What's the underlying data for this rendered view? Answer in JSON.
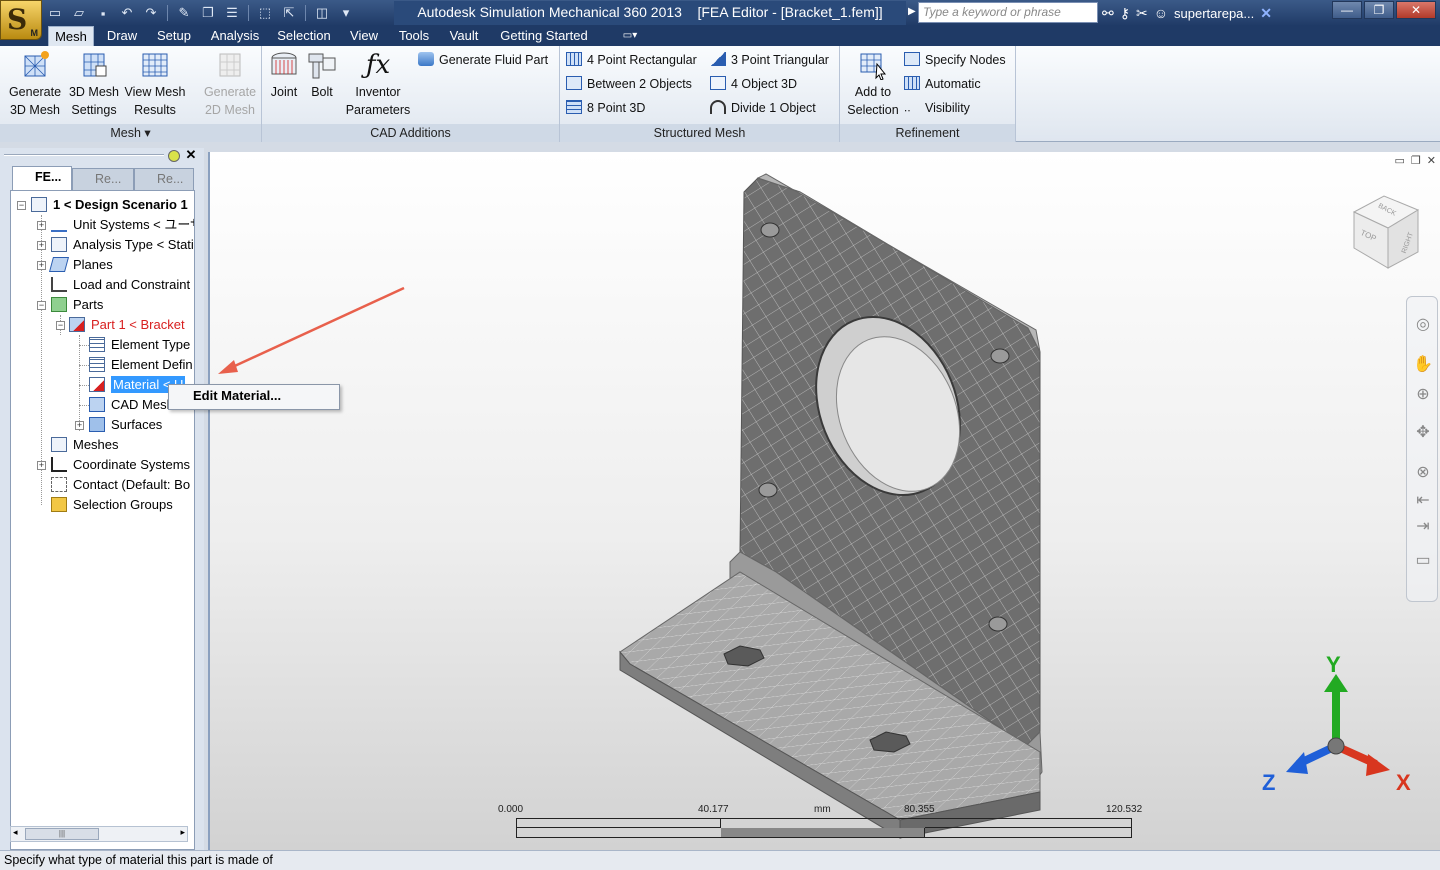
{
  "app": {
    "title": "Autodesk Simulation Mechanical 360 2013    [FEA Editor - [Bracket_1.fem]]",
    "logo_letter": "S",
    "logo_sub": "M",
    "search_placeholder": "Type a keyword or phrase",
    "user": "supertarepa..."
  },
  "menu": {
    "tabs": [
      "Mesh",
      "Draw",
      "Setup",
      "Analysis",
      "Selection",
      "View",
      "Tools",
      "Vault",
      "Getting Started"
    ],
    "active": "Mesh"
  },
  "ribbon": {
    "mesh_panel": {
      "label": "Mesh",
      "buttons": [
        {
          "line1": "Generate",
          "line2": "3D Mesh"
        },
        {
          "line1": "3D Mesh",
          "line2": "Settings"
        },
        {
          "line1": "View Mesh",
          "line2": "Results"
        },
        {
          "line1": "Generate",
          "line2": "2D Mesh"
        }
      ]
    },
    "cad_panel": {
      "label": "CAD Additions",
      "joint": "Joint",
      "bolt": "Bolt",
      "inventor_line1": "Inventor",
      "inventor_line2": "Parameters",
      "fluid": "Generate Fluid Part"
    },
    "structured_panel": {
      "label": "Structured Mesh",
      "items": [
        "4 Point Rectangular",
        "Between 2 Objects",
        "8 Point 3D",
        "3 Point Triangular",
        "4 Object 3D",
        "Divide 1 Object"
      ]
    },
    "refinement_panel": {
      "label": "Refinement",
      "add_line1": "Add to",
      "add_line2": "Selection",
      "items": [
        "Specify Nodes",
        "Automatic",
        "Visibility"
      ]
    }
  },
  "left_pane": {
    "tabs": [
      "FE...",
      "Re...",
      "Re..."
    ],
    "tree": [
      {
        "label": "1 < Design Scenario 1",
        "level": 0
      },
      {
        "label": "Unit Systems < ユーザ",
        "level": 1
      },
      {
        "label": "Analysis Type < Static",
        "level": 1
      },
      {
        "label": "Planes",
        "level": 1
      },
      {
        "label": "Load and Constraint",
        "level": 1
      },
      {
        "label": "Parts",
        "level": 1
      },
      {
        "label": "Part 1 < Bracket",
        "level": 2
      },
      {
        "label": "Element Type",
        "level": 3
      },
      {
        "label": "Element Defin",
        "level": 3
      },
      {
        "label": "Material < U",
        "level": 3
      },
      {
        "label": "CAD Mesh",
        "level": 3
      },
      {
        "label": "Surfaces",
        "level": 3
      },
      {
        "label": "Meshes",
        "level": 1
      },
      {
        "label": "Coordinate Systems",
        "level": 1
      },
      {
        "label": "Contact (Default: Bo",
        "level": 1
      },
      {
        "label": "Selection Groups",
        "level": 1
      }
    ]
  },
  "context_menu": {
    "item": "Edit Material..."
  },
  "viewport": {
    "viewcube_faces": [
      "TOP",
      "BACK",
      "RIGHT"
    ],
    "axes": [
      "Y",
      "Z",
      "X"
    ],
    "scale": {
      "ticks": [
        "0.000",
        "40.177",
        "80.355",
        "120.532"
      ],
      "unit": "mm"
    }
  },
  "status": {
    "text": "Specify what type of material this part is made of"
  },
  "colors": {
    "accent": "#1f3a66",
    "highlight": "#3399ff",
    "part_red": "#d82020",
    "axis_y": "#22aa22",
    "axis_z": "#1f5fd8",
    "axis_x": "#d8361f"
  }
}
